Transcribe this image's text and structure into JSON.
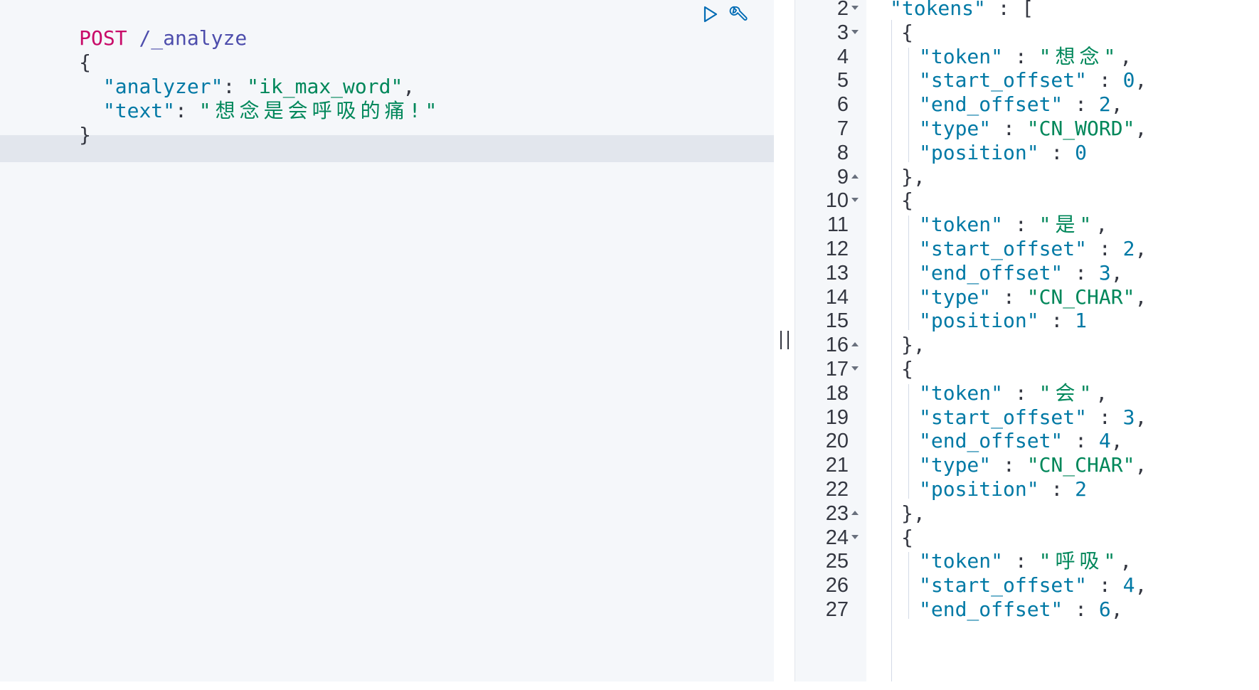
{
  "request": {
    "method": "POST",
    "path": "/_analyze",
    "open_brace": "{",
    "analyzer_key": "\"analyzer\"",
    "analyzer_value": "\"ik_max_word\"",
    "text_key": "\"text\"",
    "text_value": "\"想念是会呼吸的痛!\"",
    "close_brace": "}"
  },
  "actions": {
    "run": "play-icon",
    "settings": "wrench-icon"
  },
  "response": {
    "lines": [
      {
        "n": "2",
        "fold": "down",
        "depth": 1,
        "parts": [
          {
            "t": "\"tokens\"",
            "c": "key"
          },
          {
            "t": " : [",
            "c": "punc"
          }
        ]
      },
      {
        "n": "3",
        "fold": "down",
        "depth": 2,
        "parts": [
          {
            "t": "{",
            "c": "punc"
          }
        ]
      },
      {
        "n": "4",
        "fold": "",
        "depth": 3,
        "parts": [
          {
            "t": "\"token\"",
            "c": "key"
          },
          {
            "t": " : ",
            "c": "punc"
          },
          {
            "t": "\"想念\"",
            "c": "str"
          },
          {
            "t": ",",
            "c": "punc"
          }
        ]
      },
      {
        "n": "5",
        "fold": "",
        "depth": 3,
        "parts": [
          {
            "t": "\"start_offset\"",
            "c": "key"
          },
          {
            "t": " : ",
            "c": "punc"
          },
          {
            "t": "0",
            "c": "num"
          },
          {
            "t": ",",
            "c": "punc"
          }
        ]
      },
      {
        "n": "6",
        "fold": "",
        "depth": 3,
        "parts": [
          {
            "t": "\"end_offset\"",
            "c": "key"
          },
          {
            "t": " : ",
            "c": "punc"
          },
          {
            "t": "2",
            "c": "num"
          },
          {
            "t": ",",
            "c": "punc"
          }
        ]
      },
      {
        "n": "7",
        "fold": "",
        "depth": 3,
        "parts": [
          {
            "t": "\"type\"",
            "c": "key"
          },
          {
            "t": " : ",
            "c": "punc"
          },
          {
            "t": "\"CN_WORD\"",
            "c": "str"
          },
          {
            "t": ",",
            "c": "punc"
          }
        ]
      },
      {
        "n": "8",
        "fold": "",
        "depth": 3,
        "parts": [
          {
            "t": "\"position\"",
            "c": "key"
          },
          {
            "t": " : ",
            "c": "punc"
          },
          {
            "t": "0",
            "c": "num"
          }
        ]
      },
      {
        "n": "9",
        "fold": "up",
        "depth": 2,
        "parts": [
          {
            "t": "},",
            "c": "punc"
          }
        ]
      },
      {
        "n": "10",
        "fold": "down",
        "depth": 2,
        "parts": [
          {
            "t": "{",
            "c": "punc"
          }
        ]
      },
      {
        "n": "11",
        "fold": "",
        "depth": 3,
        "parts": [
          {
            "t": "\"token\"",
            "c": "key"
          },
          {
            "t": " : ",
            "c": "punc"
          },
          {
            "t": "\"是\"",
            "c": "str"
          },
          {
            "t": ",",
            "c": "punc"
          }
        ]
      },
      {
        "n": "12",
        "fold": "",
        "depth": 3,
        "parts": [
          {
            "t": "\"start_offset\"",
            "c": "key"
          },
          {
            "t": " : ",
            "c": "punc"
          },
          {
            "t": "2",
            "c": "num"
          },
          {
            "t": ",",
            "c": "punc"
          }
        ]
      },
      {
        "n": "13",
        "fold": "",
        "depth": 3,
        "parts": [
          {
            "t": "\"end_offset\"",
            "c": "key"
          },
          {
            "t": " : ",
            "c": "punc"
          },
          {
            "t": "3",
            "c": "num"
          },
          {
            "t": ",",
            "c": "punc"
          }
        ]
      },
      {
        "n": "14",
        "fold": "",
        "depth": 3,
        "parts": [
          {
            "t": "\"type\"",
            "c": "key"
          },
          {
            "t": " : ",
            "c": "punc"
          },
          {
            "t": "\"CN_CHAR\"",
            "c": "str"
          },
          {
            "t": ",",
            "c": "punc"
          }
        ]
      },
      {
        "n": "15",
        "fold": "",
        "depth": 3,
        "parts": [
          {
            "t": "\"position\"",
            "c": "key"
          },
          {
            "t": " : ",
            "c": "punc"
          },
          {
            "t": "1",
            "c": "num"
          }
        ]
      },
      {
        "n": "16",
        "fold": "up",
        "depth": 2,
        "parts": [
          {
            "t": "},",
            "c": "punc"
          }
        ]
      },
      {
        "n": "17",
        "fold": "down",
        "depth": 2,
        "parts": [
          {
            "t": "{",
            "c": "punc"
          }
        ]
      },
      {
        "n": "18",
        "fold": "",
        "depth": 3,
        "parts": [
          {
            "t": "\"token\"",
            "c": "key"
          },
          {
            "t": " : ",
            "c": "punc"
          },
          {
            "t": "\"会\"",
            "c": "str"
          },
          {
            "t": ",",
            "c": "punc"
          }
        ]
      },
      {
        "n": "19",
        "fold": "",
        "depth": 3,
        "parts": [
          {
            "t": "\"start_offset\"",
            "c": "key"
          },
          {
            "t": " : ",
            "c": "punc"
          },
          {
            "t": "3",
            "c": "num"
          },
          {
            "t": ",",
            "c": "punc"
          }
        ]
      },
      {
        "n": "20",
        "fold": "",
        "depth": 3,
        "parts": [
          {
            "t": "\"end_offset\"",
            "c": "key"
          },
          {
            "t": " : ",
            "c": "punc"
          },
          {
            "t": "4",
            "c": "num"
          },
          {
            "t": ",",
            "c": "punc"
          }
        ]
      },
      {
        "n": "21",
        "fold": "",
        "depth": 3,
        "parts": [
          {
            "t": "\"type\"",
            "c": "key"
          },
          {
            "t": " : ",
            "c": "punc"
          },
          {
            "t": "\"CN_CHAR\"",
            "c": "str"
          },
          {
            "t": ",",
            "c": "punc"
          }
        ]
      },
      {
        "n": "22",
        "fold": "",
        "depth": 3,
        "parts": [
          {
            "t": "\"position\"",
            "c": "key"
          },
          {
            "t": " : ",
            "c": "punc"
          },
          {
            "t": "2",
            "c": "num"
          }
        ]
      },
      {
        "n": "23",
        "fold": "up",
        "depth": 2,
        "parts": [
          {
            "t": "},",
            "c": "punc"
          }
        ]
      },
      {
        "n": "24",
        "fold": "down",
        "depth": 2,
        "parts": [
          {
            "t": "{",
            "c": "punc"
          }
        ]
      },
      {
        "n": "25",
        "fold": "",
        "depth": 3,
        "parts": [
          {
            "t": "\"token\"",
            "c": "key"
          },
          {
            "t": " : ",
            "c": "punc"
          },
          {
            "t": "\"呼吸\"",
            "c": "str"
          },
          {
            "t": ",",
            "c": "punc"
          }
        ]
      },
      {
        "n": "26",
        "fold": "",
        "depth": 3,
        "parts": [
          {
            "t": "\"start_offset\"",
            "c": "key"
          },
          {
            "t": " : ",
            "c": "punc"
          },
          {
            "t": "4",
            "c": "num"
          },
          {
            "t": ",",
            "c": "punc"
          }
        ]
      },
      {
        "n": "27",
        "fold": "",
        "depth": 3,
        "parts": [
          {
            "t": "\"end_offset\"",
            "c": "key"
          },
          {
            "t": " : ",
            "c": "punc"
          },
          {
            "t": "6",
            "c": "num"
          },
          {
            "t": ",",
            "c": "punc"
          }
        ]
      }
    ]
  },
  "colors": {
    "method": "#c80a68",
    "key": "#0079a5",
    "string": "#00875a",
    "number": "#0079a5",
    "punctuation": "#343741",
    "active_line": "#e2e6ed",
    "editor_bg": "#f5f7fa"
  }
}
